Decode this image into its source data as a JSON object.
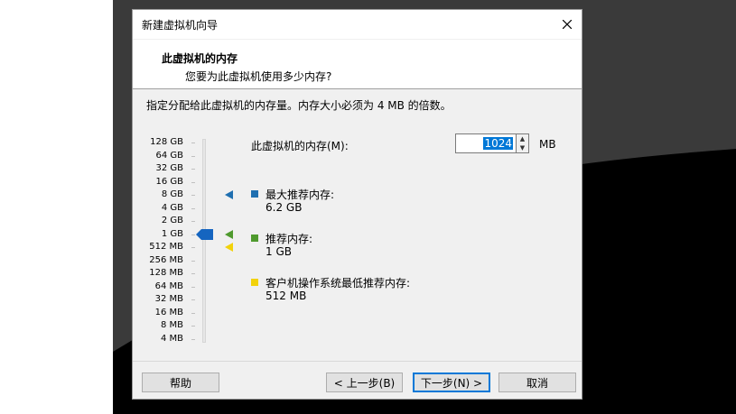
{
  "dialog": {
    "title": "新建虚拟机向导",
    "header_title": "此虚拟机的内存",
    "header_subtitle": "您要为此虚拟机使用多少内存?",
    "description": "指定分配给此虚拟机的内存量。内存大小必须为 4 MB 的倍数。"
  },
  "scale": {
    "labels": [
      "128 GB",
      "64 GB",
      "32 GB",
      "16 GB",
      "8 GB",
      "4 GB",
      "2 GB",
      "1 GB",
      "512 MB",
      "256 MB",
      "128 MB",
      "64 MB",
      "32 MB",
      "16 MB",
      "8 MB",
      "4 MB"
    ],
    "current_index": 7
  },
  "memory": {
    "label": "此虚拟机的内存(M):",
    "value": "1024",
    "unit": "MB"
  },
  "recommendations": {
    "max": {
      "label": "最大推荐内存:",
      "value": "6.2 GB",
      "color": "#1f6fb0",
      "scale_index": 4
    },
    "recommended": {
      "label": "推荐内存:",
      "value": "1 GB",
      "color": "#4f9a2e",
      "scale_index": 7
    },
    "guest_min": {
      "label": "客户机操作系统最低推荐内存:",
      "value": "512 MB",
      "color": "#f2d20a",
      "scale_index": 8
    }
  },
  "buttons": {
    "help": "帮助",
    "back": "< 上一步(B)",
    "next": "下一步(N) >",
    "cancel": "取消"
  },
  "colors": {
    "accent": "#0078d7",
    "thumb": "#1565c0"
  }
}
